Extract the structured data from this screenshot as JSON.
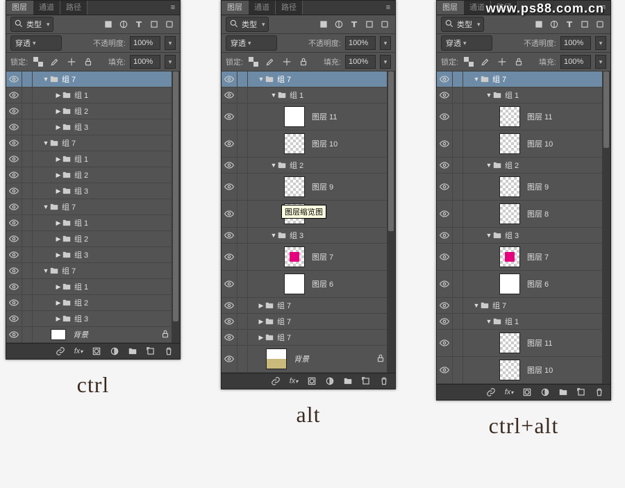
{
  "watermark": "www.ps88.com.cn",
  "captions": {
    "c1": "ctrl",
    "c2": "alt",
    "c3": "ctrl+alt"
  },
  "tabs": {
    "layers": "图层",
    "channels": "通道",
    "paths": "路径"
  },
  "filter": {
    "kind": "类型"
  },
  "blend": {
    "mode": "穿透",
    "opacity_label": "不透明度:",
    "opacity_value": "100%",
    "lock_label": "锁定:",
    "fill_label": "填充:",
    "fill_value": "100%"
  },
  "names": {
    "group7": "组 7",
    "group1": "组 1",
    "group2": "组 2",
    "group3": "组 3",
    "layer11": "图层 11",
    "layer10": "图层 10",
    "layer9": "图层 9",
    "layer8": "图层 8",
    "layer7": "图层 7",
    "layer6": "图层 6",
    "background": "背景"
  },
  "tooltip": "图层缩览图",
  "panel1": [
    {
      "t": "group",
      "sel": true,
      "open": true,
      "d": 0,
      "n": "group7"
    },
    {
      "t": "group",
      "open": false,
      "d": 1,
      "n": "group1"
    },
    {
      "t": "group",
      "open": false,
      "d": 1,
      "n": "group2"
    },
    {
      "t": "group",
      "open": false,
      "d": 1,
      "n": "group3"
    },
    {
      "t": "group",
      "open": true,
      "d": 0,
      "n": "group7"
    },
    {
      "t": "group",
      "open": false,
      "d": 1,
      "n": "group1"
    },
    {
      "t": "group",
      "open": false,
      "d": 1,
      "n": "group2"
    },
    {
      "t": "group",
      "open": false,
      "d": 1,
      "n": "group3"
    },
    {
      "t": "group",
      "open": true,
      "d": 0,
      "n": "group7"
    },
    {
      "t": "group",
      "open": false,
      "d": 1,
      "n": "group1"
    },
    {
      "t": "group",
      "open": false,
      "d": 1,
      "n": "group2"
    },
    {
      "t": "group",
      "open": false,
      "d": 1,
      "n": "group3"
    },
    {
      "t": "group",
      "open": true,
      "d": 0,
      "n": "group7"
    },
    {
      "t": "group",
      "open": false,
      "d": 1,
      "n": "group1"
    },
    {
      "t": "group",
      "open": false,
      "d": 1,
      "n": "group2"
    },
    {
      "t": "group",
      "open": false,
      "d": 1,
      "n": "group3"
    },
    {
      "t": "bg",
      "d": 0,
      "n": "background"
    }
  ],
  "panel2": [
    {
      "t": "group",
      "sel": true,
      "open": true,
      "d": 0,
      "n": "group7"
    },
    {
      "t": "group",
      "open": true,
      "d": 1,
      "n": "group1"
    },
    {
      "t": "layer",
      "d": 2,
      "n": "layer11",
      "thumb": "white"
    },
    {
      "t": "layer",
      "d": 2,
      "n": "layer10",
      "thumb": "checker"
    },
    {
      "t": "group",
      "open": true,
      "d": 1,
      "n": "group2"
    },
    {
      "t": "layer",
      "d": 2,
      "n": "layer9",
      "thumb": "checker"
    },
    {
      "t": "layer",
      "d": 2,
      "n": "",
      "thumb": "checker",
      "tooltip": true
    },
    {
      "t": "group",
      "open": true,
      "d": 1,
      "n": "group3"
    },
    {
      "t": "layer",
      "d": 2,
      "n": "layer7",
      "thumb": "magenta"
    },
    {
      "t": "layer",
      "d": 2,
      "n": "layer6",
      "thumb": "white"
    },
    {
      "t": "group",
      "open": false,
      "d": 0,
      "n": "group7"
    },
    {
      "t": "group",
      "open": false,
      "d": 0,
      "n": "group7"
    },
    {
      "t": "group",
      "open": false,
      "d": 0,
      "n": "group7"
    },
    {
      "t": "bg",
      "d": 0,
      "n": "background",
      "thumb": "browny"
    }
  ],
  "panel3": [
    {
      "t": "group",
      "sel": true,
      "open": true,
      "d": 0,
      "n": "group7"
    },
    {
      "t": "group",
      "open": true,
      "d": 1,
      "n": "group1"
    },
    {
      "t": "layer",
      "d": 2,
      "n": "layer11",
      "thumb": "checker"
    },
    {
      "t": "layer",
      "d": 2,
      "n": "layer10",
      "thumb": "checker"
    },
    {
      "t": "group",
      "open": true,
      "d": 1,
      "n": "group2"
    },
    {
      "t": "layer",
      "d": 2,
      "n": "layer9",
      "thumb": "checker"
    },
    {
      "t": "layer",
      "d": 2,
      "n": "layer8",
      "thumb": "checker"
    },
    {
      "t": "group",
      "open": true,
      "d": 1,
      "n": "group3"
    },
    {
      "t": "layer",
      "d": 2,
      "n": "layer7",
      "thumb": "magenta"
    },
    {
      "t": "layer",
      "d": 2,
      "n": "layer6",
      "thumb": "white"
    },
    {
      "t": "group",
      "open": true,
      "d": 0,
      "n": "group7"
    },
    {
      "t": "group",
      "open": true,
      "d": 1,
      "n": "group1"
    },
    {
      "t": "layer",
      "d": 2,
      "n": "layer11",
      "thumb": "checker"
    },
    {
      "t": "layer",
      "d": 2,
      "n": "layer10",
      "thumb": "checker"
    }
  ]
}
